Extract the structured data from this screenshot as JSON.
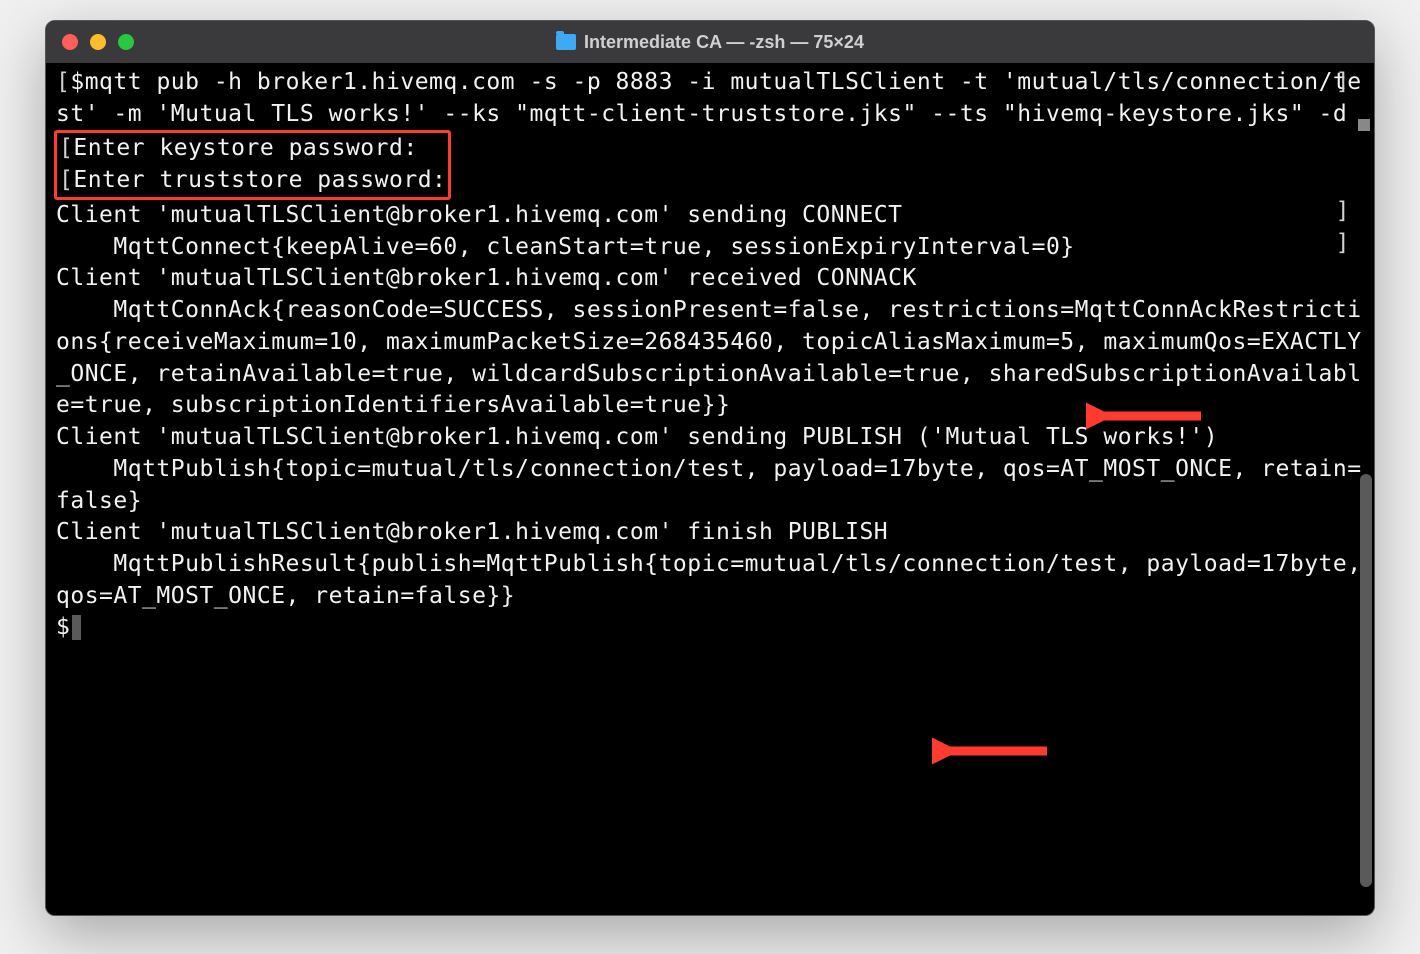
{
  "window": {
    "title": "Intermediate CA — -zsh — 75×24"
  },
  "terminal": {
    "lines": {
      "cmd1": "$mqtt pub -h broker1.hivemq.com -s -p 8883 -i mutualTLSClient -t 'mutual/tls/connection/test' -m 'Mutual TLS works!' --ks \"mqtt-client-truststore.jks\" --ts \"hivemq-keystore.jks\" -d",
      "prompt_ks": "Enter keystore password:",
      "prompt_ts": "Enter truststore password:",
      "l1": "Client 'mutualTLSClient@broker1.hivemq.com' sending CONNECT",
      "l2": "    MqttConnect{keepAlive=60, cleanStart=true, sessionExpiryInterval=0}",
      "l3": "Client 'mutualTLSClient@broker1.hivemq.com' received CONNACK",
      "l4": "    MqttConnAck{reasonCode=SUCCESS, sessionPresent=false, restrictions=MqttConnAckRestrictions{receiveMaximum=10, maximumPacketSize=268435460, topicAliasMaximum=5, maximumQos=EXACTLY_ONCE, retainAvailable=true, wildcardSubscriptionAvailable=true, sharedSubscriptionAvailable=true, subscriptionIdentifiersAvailable=true}}",
      "l5": "Client 'mutualTLSClient@broker1.hivemq.com' sending PUBLISH ('Mutual TLS works!')",
      "l6": "    MqttPublish{topic=mutual/tls/connection/test, payload=17byte, qos=AT_MOST_ONCE, retain=false}",
      "l7": "Client 'mutualTLSClient@broker1.hivemq.com' finish PUBLISH",
      "l8": "    MqttPublishResult{publish=MqttPublish{topic=mutual/tls/connection/test, payload=17byte, qos=AT_MOST_ONCE, retain=false}}",
      "prompt_end": "$"
    }
  },
  "annotations": {
    "highlight_color": "#ff3b30",
    "arrow_color": "#ff3b30"
  }
}
